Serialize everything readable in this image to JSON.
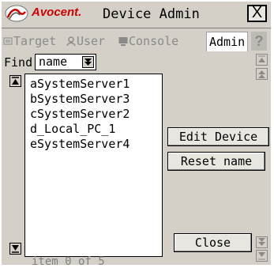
{
  "header": {
    "logo_text": "Avocent.",
    "title": "Device Admin",
    "close_glyph": "X",
    "help_glyph": "?"
  },
  "tabs": [
    {
      "label": "Target",
      "icon": "target-tab-icon",
      "active": false
    },
    {
      "label": "User",
      "icon": "user-tab-icon",
      "active": false
    },
    {
      "label": "Console",
      "icon": "console-tab-icon",
      "active": false
    },
    {
      "label": "Admin",
      "icon": "",
      "active": true
    }
  ],
  "find": {
    "label": "Find:",
    "selected": "name"
  },
  "devices": [
    "aSystemServer1",
    "bSystemServer3",
    "cSystemServer2",
    "d_Local_PC_1",
    "eSystemServer4"
  ],
  "actions": {
    "edit_device": "Edit Device",
    "reset_name": "Reset name",
    "close": "Close"
  },
  "status_text": "item 0 of 5",
  "colors": {
    "brand_red": "#cc0000",
    "panel_gray": "#d4d0c8",
    "disabled_text": "#8a8a8a"
  }
}
